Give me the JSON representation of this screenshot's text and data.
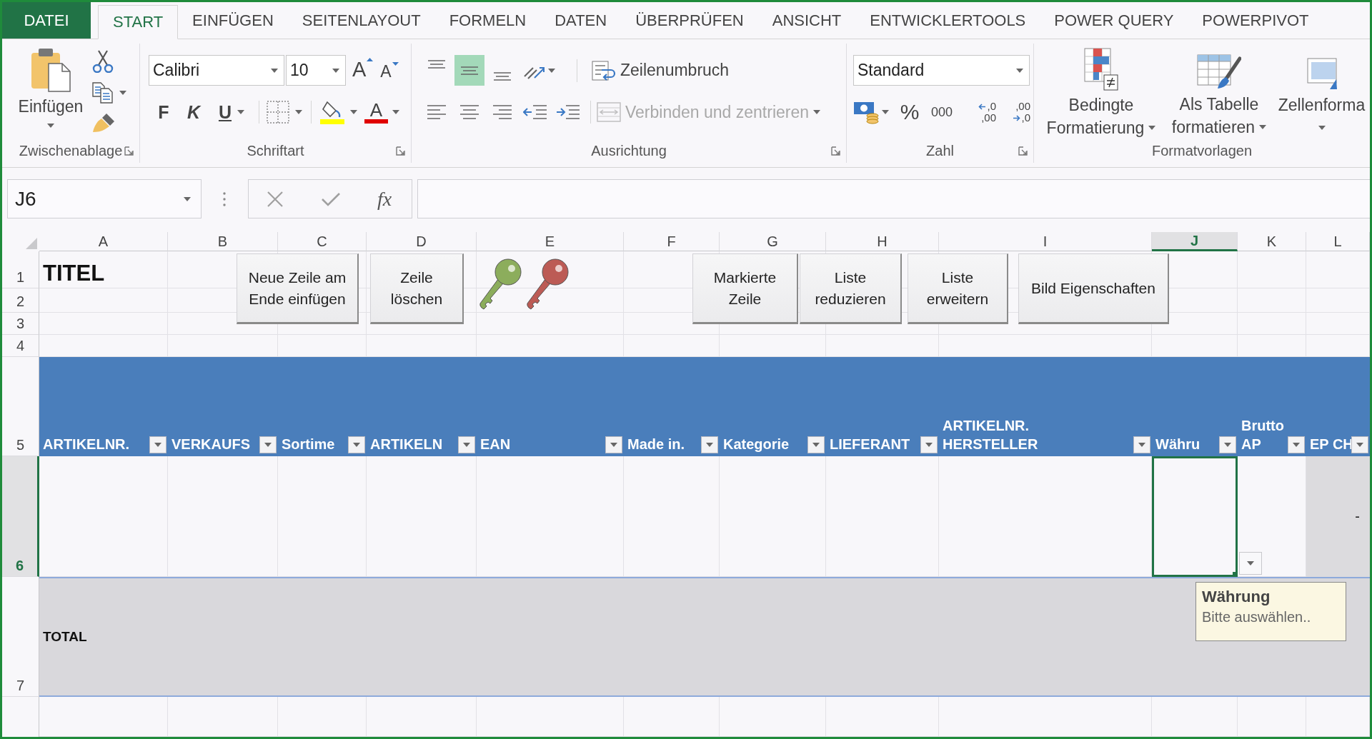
{
  "ribbon_tabs": [
    {
      "label": "DATEI",
      "kind": "file",
      "selected": false
    },
    {
      "label": "START",
      "kind": "tab",
      "selected": true
    },
    {
      "label": "EINFÜGEN",
      "kind": "tab",
      "selected": false
    },
    {
      "label": "SEITENLAYOUT",
      "kind": "tab",
      "selected": false
    },
    {
      "label": "FORMELN",
      "kind": "tab",
      "selected": false
    },
    {
      "label": "DATEN",
      "kind": "tab",
      "selected": false
    },
    {
      "label": "ÜBERPRÜFEN",
      "kind": "tab",
      "selected": false
    },
    {
      "label": "ANSICHT",
      "kind": "tab",
      "selected": false
    },
    {
      "label": "ENTWICKLERTOOLS",
      "kind": "tab",
      "selected": false
    },
    {
      "label": "POWER QUERY",
      "kind": "tab",
      "selected": false
    },
    {
      "label": "POWERPIVOT",
      "kind": "tab",
      "selected": false
    }
  ],
  "ribbon": {
    "clipboard": {
      "title": "Zwischenablage",
      "paste": "Einfügen"
    },
    "font": {
      "title": "Schriftart",
      "font_name": "Calibri",
      "font_size": "10",
      "grow_font": "A",
      "shrink_font": "A",
      "bold": "F",
      "italic": "K",
      "underline": "U",
      "font_color": "A"
    },
    "alignment": {
      "title": "Ausrichtung",
      "vertical_align": [
        {
          "selected": false
        },
        {
          "selected": true
        },
        {
          "selected": false
        }
      ],
      "wrap_text": "Zeilenumbruch",
      "merge": {
        "label": "Verbinden und zentrieren",
        "disabled": true
      }
    },
    "number": {
      "title": "Zahl",
      "format": "Standard",
      "percent": "%",
      "thousands": "000",
      "increase_decimal": [
        ",0",
        ",00"
      ],
      "decrease_decimal": [
        ",00",
        ",0"
      ]
    },
    "styles": {
      "title": "Formatvorlagen",
      "buttons": [
        {
          "lines": [
            "Bedingte",
            "Formatierung"
          ]
        },
        {
          "lines": [
            "Als Tabelle",
            "formatieren"
          ]
        },
        {
          "lines": [
            "Zellenforma"
          ]
        }
      ]
    }
  },
  "formula_bar": {
    "name_box": "J6",
    "function_button": "fx"
  },
  "sheet": {
    "columns": [
      {
        "label": "A",
        "selected": false
      },
      {
        "label": "B",
        "selected": false
      },
      {
        "label": "C",
        "selected": false
      },
      {
        "label": "D",
        "selected": false
      },
      {
        "label": "E",
        "selected": false
      },
      {
        "label": "F",
        "selected": false
      },
      {
        "label": "G",
        "selected": false
      },
      {
        "label": "H",
        "selected": false
      },
      {
        "label": "I",
        "selected": false
      },
      {
        "label": "J",
        "selected": true
      },
      {
        "label": "K",
        "selected": false
      },
      {
        "label": "L",
        "selected": false
      }
    ],
    "rows": [
      {
        "label": "1",
        "selected": false
      },
      {
        "label": "2",
        "selected": false
      },
      {
        "label": "3",
        "selected": false
      },
      {
        "label": "4",
        "selected": false
      },
      {
        "label": "5",
        "selected": false
      },
      {
        "label": "6",
        "selected": true
      },
      {
        "label": "7",
        "selected": false
      }
    ],
    "title": "TITEL",
    "macro_buttons": [
      {
        "lines": [
          "Neue Zeile am",
          "Ende einfügen"
        ]
      },
      {
        "lines": [
          "Zeile",
          "löschen"
        ]
      },
      {
        "lines": [
          "Markierte",
          "Zeile"
        ]
      },
      {
        "lines": [
          "Liste",
          "reduzieren"
        ]
      },
      {
        "lines": [
          "Liste",
          "erweitern"
        ]
      },
      {
        "lines": [
          "Bild Eigenschaften"
        ]
      }
    ],
    "keys": [
      {
        "color": "#8cad5c"
      },
      {
        "color": "#bc5b55"
      }
    ],
    "table": {
      "headers": [
        {
          "lines": [
            "ARTIKELNR."
          ]
        },
        {
          "lines": [
            "VERKAUFS"
          ]
        },
        {
          "lines": [
            "Sortime"
          ]
        },
        {
          "lines": [
            "ARTIKELN"
          ]
        },
        {
          "lines": [
            "EAN"
          ]
        },
        {
          "lines": [
            "Made in."
          ]
        },
        {
          "lines": [
            "Kategorie"
          ]
        },
        {
          "lines": [
            "LIEFERANT"
          ]
        },
        {
          "lines": [
            "ARTIKELNR.",
            "HERSTELLER"
          ]
        },
        {
          "lines": [
            "Währu"
          ]
        },
        {
          "lines": [
            "Brutto",
            "AP"
          ]
        },
        {
          "lines": [
            "EP CH"
          ]
        }
      ],
      "data_row": [
        {
          "kind": "input"
        },
        {
          "kind": "input"
        },
        {
          "kind": "input"
        },
        {
          "kind": "input"
        },
        {
          "kind": "input"
        },
        {
          "kind": "input"
        },
        {
          "kind": "input"
        },
        {
          "kind": "input"
        },
        {
          "kind": "input"
        },
        {
          "kind": "input"
        },
        {
          "kind": "input"
        },
        {
          "kind": "formula",
          "value": "-"
        }
      ],
      "total_label": "TOTAL"
    }
  },
  "validation_tooltip": {
    "title": "Währung",
    "message": "Bitte auswählen.."
  }
}
